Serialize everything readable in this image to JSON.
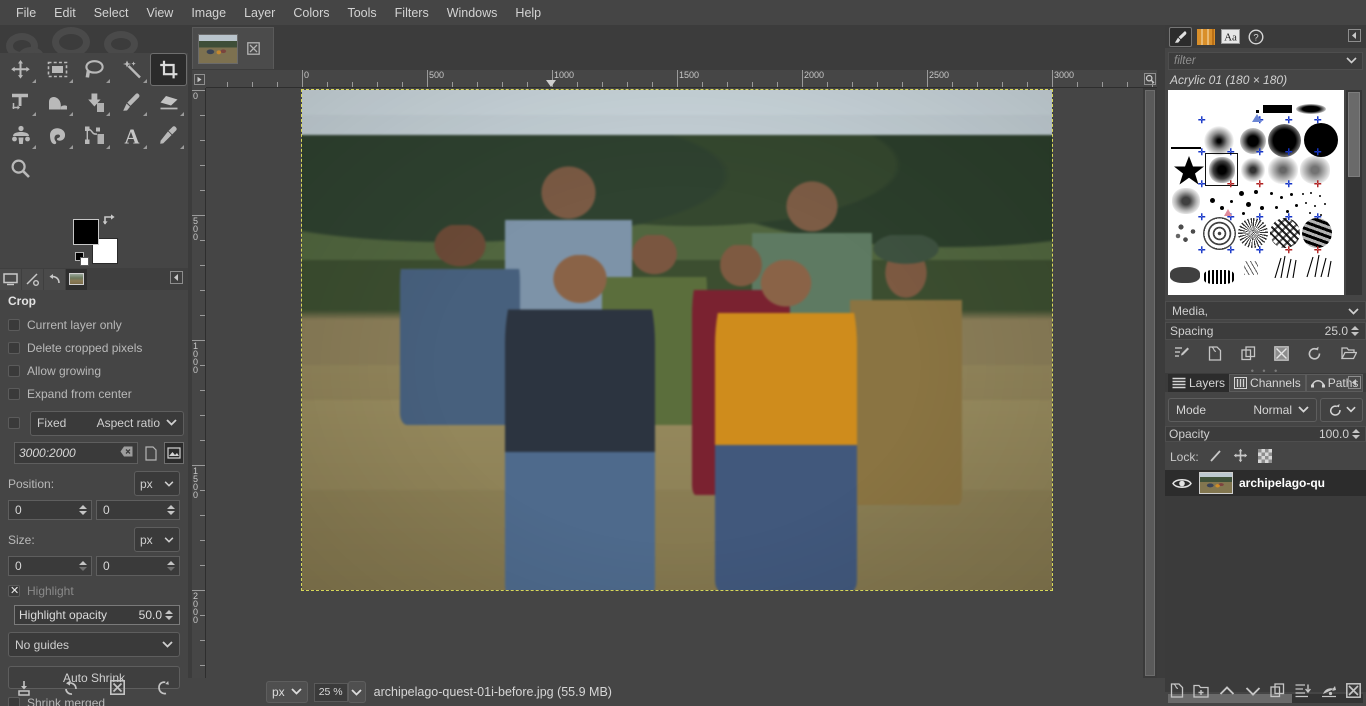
{
  "app": {
    "title": "GIMP"
  },
  "menubar": {
    "items": [
      {
        "label": "File",
        "name": "menu-file"
      },
      {
        "label": "Edit",
        "name": "menu-edit"
      },
      {
        "label": "Select",
        "name": "menu-select"
      },
      {
        "label": "View",
        "name": "menu-view"
      },
      {
        "label": "Image",
        "name": "menu-image"
      },
      {
        "label": "Layer",
        "name": "menu-layer"
      },
      {
        "label": "Colors",
        "name": "menu-colors"
      },
      {
        "label": "Tools",
        "name": "menu-tools"
      },
      {
        "label": "Filters",
        "name": "menu-filters"
      },
      {
        "label": "Windows",
        "name": "menu-windows"
      },
      {
        "label": "Help",
        "name": "menu-help"
      }
    ]
  },
  "toolbox": {
    "tools": [
      {
        "name": "move-tool",
        "icon": "move-icon",
        "active": false
      },
      {
        "name": "rectangle-select-tool",
        "icon": "rectangle-select-icon",
        "active": false
      },
      {
        "name": "free-select-tool",
        "icon": "lasso-icon",
        "active": false
      },
      {
        "name": "fuzzy-select-tool",
        "icon": "magic-wand-icon",
        "active": false
      },
      {
        "name": "crop-tool",
        "icon": "crop-icon",
        "active": true
      },
      {
        "name": "transform-tool",
        "icon": "unified-transform-icon",
        "active": false
      },
      {
        "name": "warp-tool",
        "icon": "warp-icon",
        "active": false
      },
      {
        "name": "bucket-fill-tool",
        "icon": "bucket-fill-icon",
        "active": false
      },
      {
        "name": "paintbrush-tool",
        "icon": "paintbrush-icon",
        "active": false
      },
      {
        "name": "eraser-tool",
        "icon": "eraser-icon",
        "active": false
      },
      {
        "name": "clone-tool",
        "icon": "clone-stamp-icon",
        "active": false
      },
      {
        "name": "smudge-tool",
        "icon": "smudge-icon",
        "active": false
      },
      {
        "name": "paths-tool",
        "icon": "paths-icon",
        "active": false
      },
      {
        "name": "text-tool",
        "icon": "text-a-icon",
        "active": false
      },
      {
        "name": "color-picker-tool",
        "icon": "eyedropper-icon",
        "active": false
      },
      {
        "name": "zoom-tool",
        "icon": "magnifier-icon",
        "active": false
      }
    ],
    "foreground_color": "#000000",
    "background_color": "#ffffff",
    "swap_icon": "swap-colors-icon",
    "default_colors_icon": "default-colors-icon",
    "image_buttons": [
      {
        "name": "device-status-button",
        "icon": "display-icon",
        "selected": false
      },
      {
        "name": "tool-preset-button",
        "icon": "tool-preset-icon",
        "selected": false
      },
      {
        "name": "undo-history-button",
        "icon": "undo-history-icon",
        "selected": false
      },
      {
        "name": "images-button",
        "icon": "image-thumb-icon",
        "selected": true
      }
    ]
  },
  "tool_options": {
    "title": "Crop",
    "checkboxes": [
      {
        "label": "Current layer only",
        "checked": false,
        "name": "current-layer-only-checkbox"
      },
      {
        "label": "Delete cropped pixels",
        "checked": false,
        "name": "delete-cropped-pixels-checkbox"
      },
      {
        "label": "Allow growing",
        "checked": false,
        "name": "allow-growing-checkbox"
      },
      {
        "label": "Expand from center",
        "checked": false,
        "name": "expand-from-center-checkbox"
      }
    ],
    "fixed": {
      "label": "Fixed",
      "checked": false,
      "mode": "Aspect ratio"
    },
    "ratio_value": "3000:2000",
    "ratio_clear_icon": "clear-entry-icon",
    "portrait_icon": "portrait-orientation-icon",
    "landscape_icon": "landscape-orientation-icon",
    "position": {
      "label": "Position:",
      "unit": "px",
      "x": "0",
      "y": "0"
    },
    "size": {
      "label": "Size:",
      "unit": "px",
      "w": "0",
      "h": "0"
    },
    "highlight": {
      "label": "Highlight",
      "checked": true
    },
    "highlight_opacity": {
      "label": "Highlight opacity",
      "value": "50.0"
    },
    "guides": "No guides",
    "auto_shrink": "Auto Shrink",
    "shrink_merged": {
      "label": "Shrink merged",
      "checked": false
    },
    "footer_buttons": [
      {
        "name": "save-tool-options-button",
        "icon": "save-icon"
      },
      {
        "name": "restore-tool-options-button",
        "icon": "restore-icon"
      },
      {
        "name": "delete-tool-options-button",
        "icon": "delete-x-icon"
      },
      {
        "name": "reset-tool-options-button",
        "icon": "reset-icon"
      }
    ]
  },
  "canvas": {
    "tab": {
      "name": "image-tab",
      "close_icon": "close-icon"
    },
    "ruler_unit": "px",
    "ruler_top_labels": [
      "0",
      "500",
      "1000",
      "1500",
      "2000",
      "2500",
      "3000"
    ],
    "ruler_left_labels": [
      "0",
      "500",
      "1000",
      "1500",
      "2000"
    ],
    "quickmask_icon": "quick-mask-icon",
    "zoom_image_icon": "zoom-fit-icon",
    "nav_icon": "navigation-icon",
    "menu_arrow_icon": "menu-arrow-icon"
  },
  "statusbar": {
    "unit": "px",
    "zoom": "25 %",
    "text": "archipelago-quest-01i-before.jpg (55.9 MB)"
  },
  "right_dock": {
    "tabs": [
      {
        "name": "tab-brushes",
        "icon": "brush-icon",
        "selected": true
      },
      {
        "name": "tab-patterns",
        "icon": "pattern-icon",
        "selected": false
      },
      {
        "name": "tab-fonts",
        "icon": "fonts-aa-icon",
        "selected": false
      },
      {
        "name": "tab-document-history",
        "icon": "help-question-icon",
        "selected": false
      }
    ],
    "collapse_icon": "collapse-dock-icon",
    "filter_placeholder": "filter",
    "filter_caret_icon": "chevron-down-icon",
    "brush_name": "Acrylic 01 (180 × 180)",
    "media_label": "Media,",
    "media_caret_icon": "chevron-down-icon",
    "spacing": {
      "label": "Spacing",
      "value": "25.0"
    },
    "brush_buttons": [
      {
        "name": "edit-brush-button",
        "icon": "edit-brush-icon"
      },
      {
        "name": "new-brush-button",
        "icon": "new-brush-icon"
      },
      {
        "name": "duplicate-brush-button",
        "icon": "duplicate-icon"
      },
      {
        "name": "delete-brush-button",
        "icon": "delete-brush-icon"
      },
      {
        "name": "refresh-brushes-button",
        "icon": "refresh-icon"
      },
      {
        "name": "open-brush-folder-button",
        "icon": "open-folder-icon"
      }
    ]
  },
  "layers_panel": {
    "tabs": [
      {
        "label": "Layers",
        "icon": "layers-icon",
        "selected": true,
        "name": "tab-layers"
      },
      {
        "label": "Channels",
        "icon": "channels-icon",
        "selected": false,
        "name": "tab-channels"
      },
      {
        "label": "Paths",
        "icon": "paths-icon",
        "selected": false,
        "name": "tab-paths"
      }
    ],
    "collapse_icon": "collapse-dock-icon",
    "mode": {
      "label": "Mode",
      "value": "Normal"
    },
    "mode_extra_icon": "blend-space-icon",
    "opacity": {
      "label": "Opacity",
      "value": "100.0"
    },
    "lock": {
      "label": "Lock:",
      "items": [
        {
          "name": "lock-pixels-button",
          "icon": "lock-pixels-brush-icon"
        },
        {
          "name": "lock-position-button",
          "icon": "lock-position-move-icon"
        },
        {
          "name": "lock-alpha-button",
          "icon": "lock-alpha-checker-icon"
        }
      ]
    },
    "layers": [
      {
        "name": "archipelago-qu",
        "visible": true,
        "visibility_icon": "eye-icon",
        "thumb": "layer-thumbnail"
      }
    ],
    "buttons": [
      {
        "name": "new-layer-button",
        "icon": "new-layer-icon"
      },
      {
        "name": "new-layer-group-button",
        "icon": "new-group-icon"
      },
      {
        "name": "raise-layer-button",
        "icon": "chevron-up-icon"
      },
      {
        "name": "lower-layer-button",
        "icon": "chevron-down-icon"
      },
      {
        "name": "duplicate-layer-button",
        "icon": "duplicate-icon"
      },
      {
        "name": "merge-down-button",
        "icon": "merge-down-icon"
      },
      {
        "name": "anchor-layer-button",
        "icon": "anchor-icon"
      },
      {
        "name": "delete-layer-button",
        "icon": "delete-x-icon"
      }
    ]
  },
  "colors": {
    "bg_dark": "#454545",
    "panel": "#3c3c3c",
    "accent_selection": "#d8d85a",
    "text": "#bdbdbd"
  }
}
